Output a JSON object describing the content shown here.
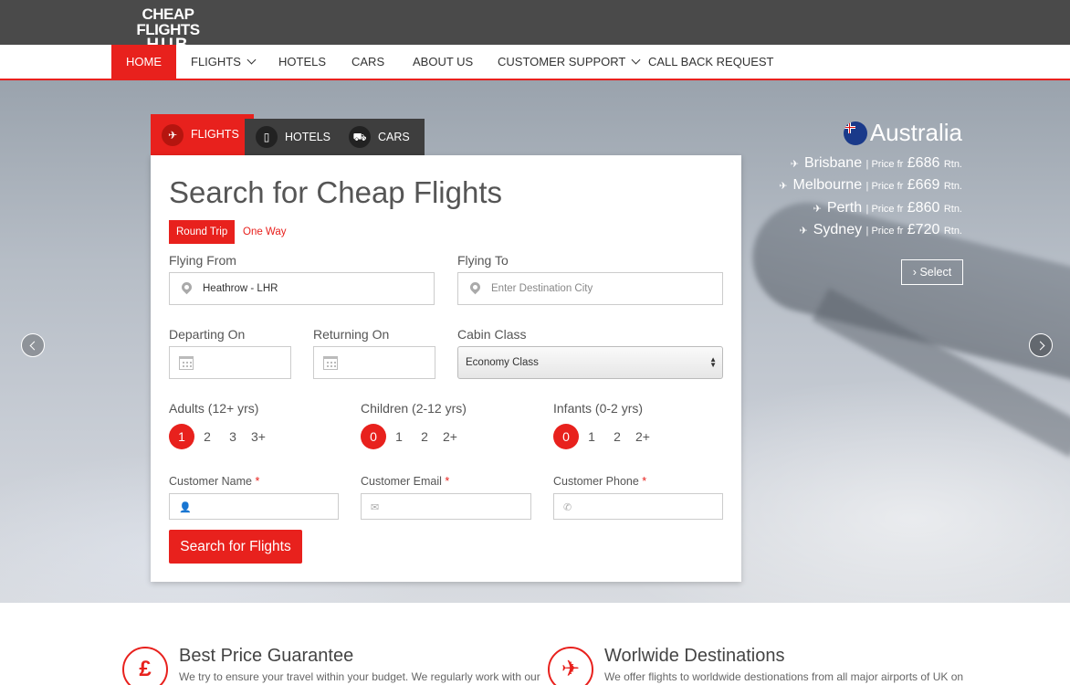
{
  "brand": {
    "line1": "CHEAP FLIGHTS",
    "line2": "HUB"
  },
  "nav": {
    "home": "HOME",
    "flights": "FLIGHTS",
    "hotels": "HOTELS",
    "cars": "CARS",
    "about": "ABOUT US",
    "support": "CUSTOMER SUPPORT",
    "callback": "CALL BACK REQUEST"
  },
  "tabs": {
    "flights": "FLIGHTS",
    "hotels": "HOTELS",
    "cars": "CARS"
  },
  "form": {
    "title": "Search for Cheap Flights",
    "round_trip": "Round Trip",
    "one_way": "One Way",
    "from_label": "Flying From",
    "from_value": "Heathrow - LHR",
    "to_label": "Flying To",
    "to_placeholder": "Enter Destination City",
    "depart_label": "Departing On",
    "return_label": "Returning On",
    "cabin_label": "Cabin Class",
    "cabin_value": "Economy Class",
    "adults_label": "Adults (12+ yrs)",
    "children_label": "Children (2-12 yrs)",
    "infants_label": "Infants (0-2 yrs)",
    "adults": [
      "1",
      "2",
      "3",
      "3+"
    ],
    "children": [
      "0",
      "1",
      "2",
      "2+"
    ],
    "infants": [
      "0",
      "1",
      "2",
      "2+"
    ],
    "name_label": "Customer Name",
    "email_label": "Customer Email",
    "phone_label": "Customer Phone",
    "required_mark": "*",
    "submit": "Search for Flights"
  },
  "promo": {
    "country": "Australia",
    "price_prefix": "| Price fr",
    "price_suffix": "Rtn.",
    "destinations": [
      {
        "city": "Brisbane",
        "price": "£686"
      },
      {
        "city": "Melbourne",
        "price": "£669"
      },
      {
        "city": "Perth",
        "price": "£860"
      },
      {
        "city": "Sydney",
        "price": "£720"
      }
    ],
    "select": "Select"
  },
  "features": [
    {
      "icon": "£",
      "title": "Best Price Guarantee",
      "text": "We try to ensure your travel within your budget. We regularly work with our"
    },
    {
      "icon": "✈",
      "title": "Worlwide Destinations",
      "text": "We offer flights to worldwide destionations from all major airports of UK on"
    }
  ],
  "colors": {
    "accent": "#e8211d",
    "header": "#4a4a4a"
  }
}
